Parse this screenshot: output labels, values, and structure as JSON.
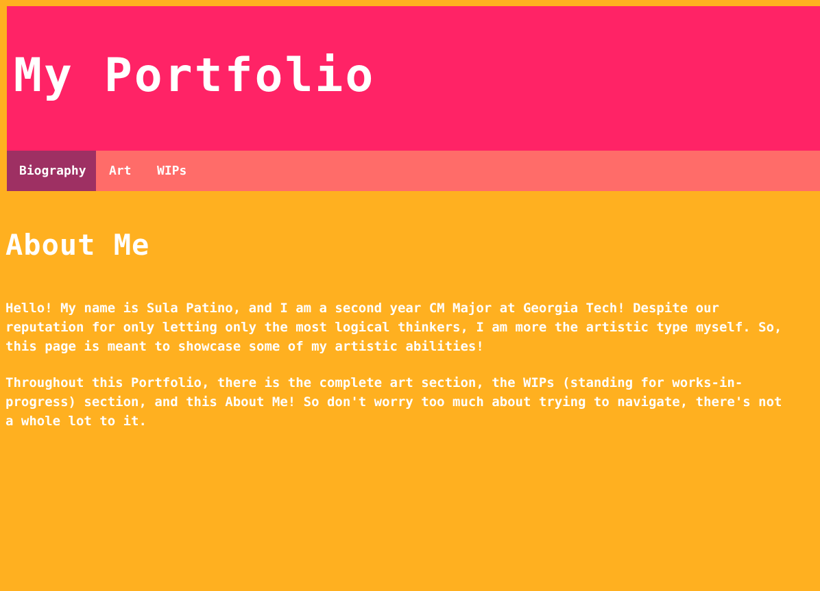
{
  "header": {
    "title": "My Portfolio"
  },
  "nav": {
    "items": [
      {
        "label": "Biography",
        "active": true
      },
      {
        "label": "Art",
        "active": false
      },
      {
        "label": "WIPs",
        "active": false
      }
    ]
  },
  "main": {
    "heading": "About Me",
    "paragraphs": [
      "Hello! My name is Sula Patino, and I am a second year CM Major at Georgia Tech! Despite our reputation for only letting only the most logical thinkers, I am more the artistic type myself. So, this page is meant to showcase some of my artistic abilities!",
      "Throughout this Portfolio, there is the complete art section, the WIPs (standing for works-in-progress) section, and this About Me! So don't worry too much about trying to navigate, there's not a whole lot to it."
    ]
  },
  "colors": {
    "background": "#FFB020",
    "header": "#FF2366",
    "nav": "#FF6C69",
    "nav_active": "#9E3063",
    "text": "#FFFFFF"
  }
}
